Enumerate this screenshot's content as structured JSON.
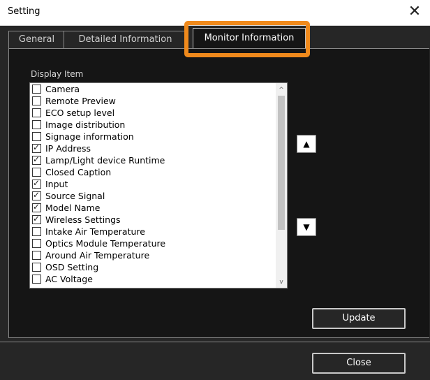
{
  "window": {
    "title": "Setting",
    "close_glyph": "✕"
  },
  "tabs": [
    {
      "label": "General"
    },
    {
      "label": "Detailed Information"
    },
    {
      "label": "Monitor Information"
    }
  ],
  "display_item": {
    "label": "Display Item",
    "items": [
      {
        "label": "Camera",
        "checked": false
      },
      {
        "label": "Remote Preview",
        "checked": false
      },
      {
        "label": "ECO setup level",
        "checked": false
      },
      {
        "label": "Image distribution",
        "checked": false
      },
      {
        "label": "Signage information",
        "checked": false
      },
      {
        "label": "IP Address",
        "checked": true
      },
      {
        "label": "Lamp/Light device Runtime",
        "checked": true
      },
      {
        "label": "Closed Caption",
        "checked": false
      },
      {
        "label": "Input",
        "checked": true
      },
      {
        "label": "Source Signal",
        "checked": true
      },
      {
        "label": "Model Name",
        "checked": true
      },
      {
        "label": "Wireless Settings",
        "checked": true
      },
      {
        "label": "Intake Air Temperature",
        "checked": false
      },
      {
        "label": "Optics Module Temperature",
        "checked": false
      },
      {
        "label": "Around Air Temperature",
        "checked": false
      },
      {
        "label": "OSD Setting",
        "checked": false
      },
      {
        "label": "AC Voltage",
        "checked": false
      }
    ]
  },
  "buttons": {
    "move_up": "▲",
    "move_down": "▼",
    "update": "Update",
    "close": "Close"
  },
  "scrollbar": {
    "up_glyph": "^",
    "down_glyph": "v"
  },
  "colors": {
    "highlight": "#f08a1c",
    "background": "#262626",
    "panel": "#151515"
  }
}
